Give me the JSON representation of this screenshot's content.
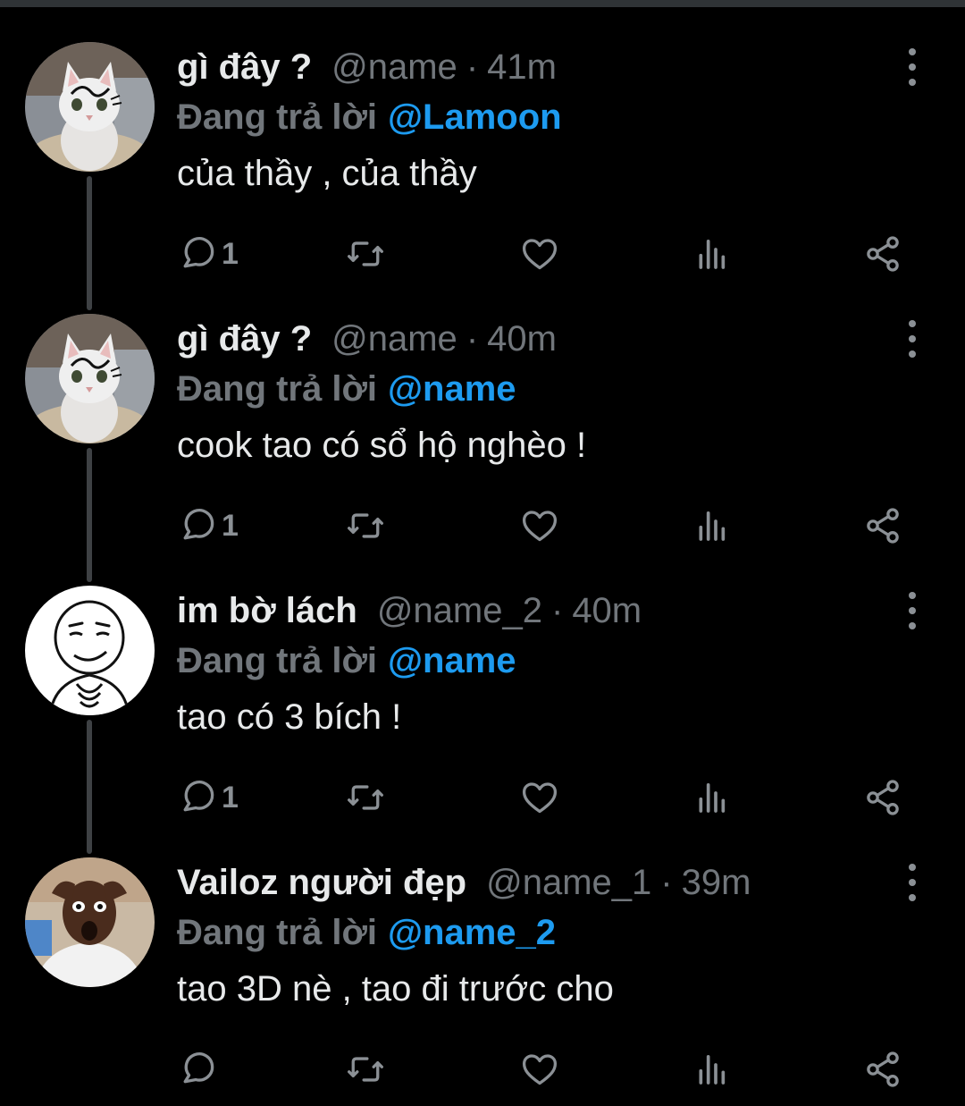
{
  "tweets": [
    {
      "display_name": "gì đây ?",
      "handle": "@name",
      "separator": "·",
      "time": "41m",
      "reply_prefix": "Đang trả lời",
      "reply_to": "@Lamoon",
      "text": "của thầy , của thầy",
      "reply_count": "1",
      "avatar": "cat-avatar"
    },
    {
      "display_name": "gì đây ?",
      "handle": "@name",
      "separator": "·",
      "time": "40m",
      "reply_prefix": "Đang trả lời",
      "reply_to": "@name",
      "text": "cook tao có sổ hộ nghèo !",
      "reply_count": "1",
      "avatar": "cat-avatar"
    },
    {
      "display_name": "im bờ lách",
      "handle": "@name_2",
      "separator": "·",
      "time": "40m",
      "reply_prefix": "Đang trả lời",
      "reply_to": "@name",
      "text": "tao có 3 bích !",
      "reply_count": "1",
      "avatar": "meme-face-avatar"
    },
    {
      "display_name": "Vailoz người đẹp",
      "handle": "@name_1",
      "separator": "·",
      "time": "39m",
      "reply_prefix": "Đang trả lời",
      "reply_to": "@name_2",
      "text": "tao 3D nè , tao đi trước cho",
      "reply_count": "",
      "avatar": "surprised-man-avatar"
    }
  ],
  "icons": {
    "reply": "reply-icon",
    "retweet": "retweet-icon",
    "like": "heart-icon",
    "views": "views-icon",
    "share": "share-icon",
    "more": "more-icon"
  },
  "colors": {
    "background": "#000000",
    "text": "#e7e9ea",
    "muted": "#71767b",
    "link": "#1d9bf0",
    "thread_line": "#3e4144"
  }
}
